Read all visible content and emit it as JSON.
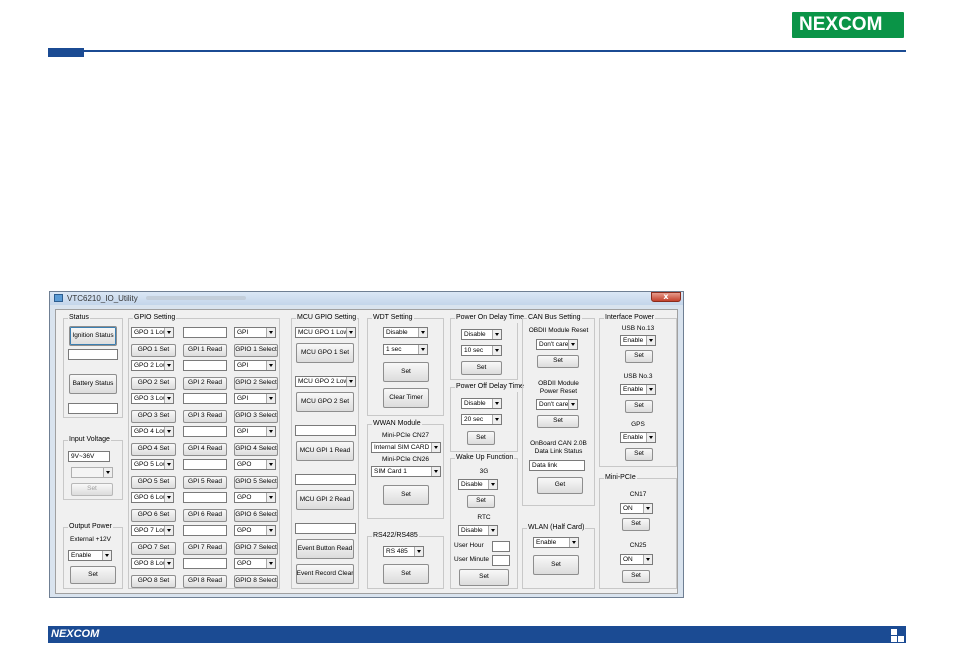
{
  "branding": {
    "logo_text": "NEXCOM",
    "footer_logo_text": "NEXCOM",
    "colors": {
      "brand_blue": "#1b4b93",
      "brand_green": "#0a9447"
    }
  },
  "window": {
    "title": "VTC6210_IO_Utility",
    "close_glyph": "x"
  },
  "status": {
    "group": "Status",
    "ignition_button": "Ignition Status",
    "ignition_value": "",
    "battery_button": "Battery Status",
    "battery_value": ""
  },
  "input_voltage": {
    "group": "Input Voltage",
    "value": "9V~36V",
    "select_value": "",
    "set": "Set"
  },
  "output_power": {
    "group": "Output Power",
    "label": "External +12V",
    "select": "Enable",
    "set": "Set"
  },
  "gpio": {
    "group": "GPIO Setting",
    "rows": [
      {
        "gpo_select": "GPO 1 Low",
        "gpo_set": "GPO 1 Set",
        "gpi_value": "",
        "gpi_read": "GPI 1 Read",
        "io_select": "GPI",
        "io_set": "GPIO 1 Select"
      },
      {
        "gpo_select": "GPO 2 Low",
        "gpo_set": "GPO 2 Set",
        "gpi_value": "",
        "gpi_read": "GPI 2 Read",
        "io_select": "GPI",
        "io_set": "GPIO 2 Select"
      },
      {
        "gpo_select": "GPO 3 Low",
        "gpo_set": "GPO 3 Set",
        "gpi_value": "",
        "gpi_read": "GPI 3 Read",
        "io_select": "GPI",
        "io_set": "GPIO 3 Select"
      },
      {
        "gpo_select": "GPO 4 Low",
        "gpo_set": "GPO 4 Set",
        "gpi_value": "",
        "gpi_read": "GPI 4 Read",
        "io_select": "GPI",
        "io_set": "GPIO 4 Select"
      },
      {
        "gpo_select": "GPO 5 Low",
        "gpo_set": "GPO 5 Set",
        "gpi_value": "",
        "gpi_read": "GPI 5 Read",
        "io_select": "GPO",
        "io_set": "GPIO 5 Select"
      },
      {
        "gpo_select": "GPO 6 Low",
        "gpo_set": "GPO 6 Set",
        "gpi_value": "",
        "gpi_read": "GPI 6 Read",
        "io_select": "GPO",
        "io_set": "GPIO 6 Select"
      },
      {
        "gpo_select": "GPO 7 Low",
        "gpo_set": "GPO 7 Set",
        "gpi_value": "",
        "gpi_read": "GPI 7 Read",
        "io_select": "GPO",
        "io_set": "GPIO 7 Select"
      },
      {
        "gpo_select": "GPO 8 Low",
        "gpo_set": "GPO 8 Set",
        "gpi_value": "",
        "gpi_read": "GPI 8 Read",
        "io_select": "GPO",
        "io_set": "GPIO 8 Select"
      }
    ]
  },
  "mcu_gpio": {
    "group": "MCU GPIO Setting",
    "gpo1_select": "MCU GPO 1 Low",
    "gpo1_set": "MCU GPO 1 Set",
    "gpo2_select": "MCU GPO 2 Low",
    "gpo2_set": "MCU GPO 2 Set",
    "gpi1_value": "",
    "gpi1_read": "MCU GPI 1 Read",
    "gpi2_value": "",
    "gpi2_read": "MCU GPI 2 Read",
    "event_value": "",
    "event_read": "Event Button Read",
    "event_clear": "Event Record Clear"
  },
  "wdt": {
    "group": "WDT Setting",
    "mode": "Disable",
    "time": "1 sec",
    "set": "Set",
    "clear": "Clear Timer"
  },
  "wwan": {
    "group": "WWAN Module",
    "cn27_label": "Mini-PCIe CN27",
    "cn27_value": "Internal SIM CARD",
    "cn26_label": "Mini-PCIe CN26",
    "cn26_value": "SIM Card 1",
    "set": "Set"
  },
  "rs422": {
    "group": "RS422/RS485",
    "value": "RS 485",
    "set": "Set"
  },
  "power_on_delay": {
    "group": "Power On Delay Time",
    "mode": "Disable",
    "time": "10 sec",
    "set": "Set"
  },
  "power_off_delay": {
    "group": "Power Off Delay Time",
    "mode": "Disable",
    "time": "20 sec",
    "set": "Set"
  },
  "wake_up": {
    "group": "Wake Up Function",
    "3g_label": "3G",
    "3g_value": "Disable",
    "3g_set": "Set",
    "rtc_label": "RTC",
    "rtc_value": "Disable",
    "user_hour_label": "User Hour",
    "user_hour_value": "",
    "user_minute_label": "User Minute",
    "user_minute_value": "",
    "set": "Set"
  },
  "can_bus": {
    "group": "CAN Bus Setting",
    "obdii_reset_label": "OBDII Module Reset",
    "obdii_reset_value": "Don't care",
    "obdii_reset_set": "Set",
    "obdii_power_label1": "OBDII Module",
    "obdii_power_label2": "Power Reset",
    "obdii_power_value": "Don't care",
    "obdii_power_set": "Set",
    "can_label1": "OnBoard CAN 2.0B",
    "can_label2": "Data Link Status",
    "can_value": "Data link",
    "can_get": "Get"
  },
  "wlan": {
    "group": "WLAN (Half Card)",
    "value": "Enable",
    "set": "Set"
  },
  "interface_power": {
    "group": "Interface Power",
    "usb13_label": "USB No.13",
    "usb13_value": "Enable",
    "usb13_set": "Set",
    "usb3_label": "USB No.3",
    "usb3_value": "Enable",
    "usb3_set": "Set",
    "gps_label": "GPS",
    "gps_value": "Enable",
    "gps_set": "Set"
  },
  "mini_pcie": {
    "group": "Mini-PCIe",
    "cn17_label": "CN17",
    "cn17_value": "ON",
    "cn17_set": "Set",
    "cn25_label": "CN25",
    "cn25_value": "ON",
    "cn25_set": "Set"
  }
}
